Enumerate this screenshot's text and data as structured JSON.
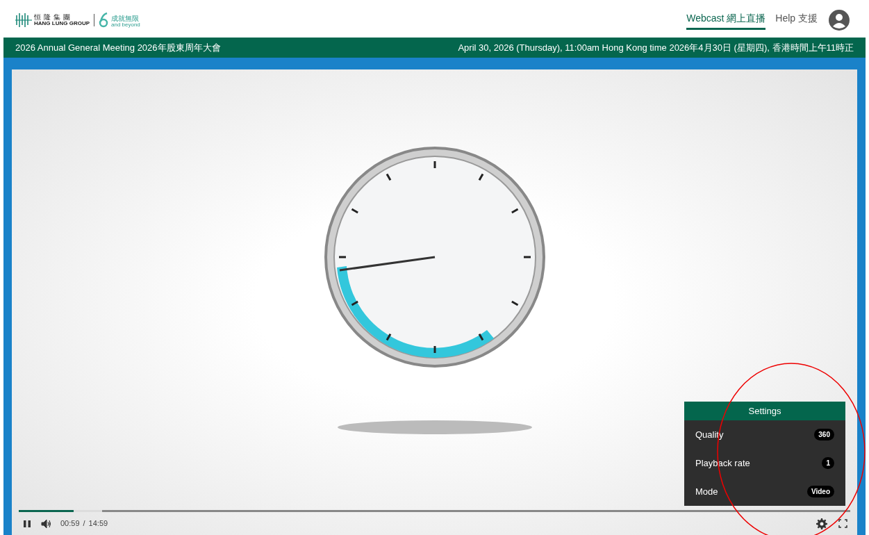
{
  "header": {
    "logo_chinese": "恒隆集團",
    "logo_english": "HANG LUNG GROUP",
    "anniversary_chinese": "成就無限",
    "anniversary_english": "and beyond",
    "nav": [
      {
        "label": "Webcast 網上直播",
        "selected": true
      },
      {
        "label": "Help 支援",
        "selected": false
      }
    ]
  },
  "event_bar": {
    "title": "2026 Annual General Meeting 2026年股東周年大會",
    "date": "April 30, 2026 (Thursday), 11:00am Hong Kong time 2026年4月30日 (星期四), 香港時間上午11時正"
  },
  "player": {
    "progress": {
      "level": 0.066
    },
    "buffered": {
      "level": 0.1
    },
    "playing": true,
    "current_time": "00:59",
    "separator": "/",
    "duration": "14:59",
    "settings": {
      "title": "Settings",
      "items": [
        {
          "label": "Quality",
          "value": "360"
        },
        {
          "label": "Playback rate",
          "value": "1"
        },
        {
          "label": "Mode",
          "value": "Video"
        }
      ]
    }
  }
}
